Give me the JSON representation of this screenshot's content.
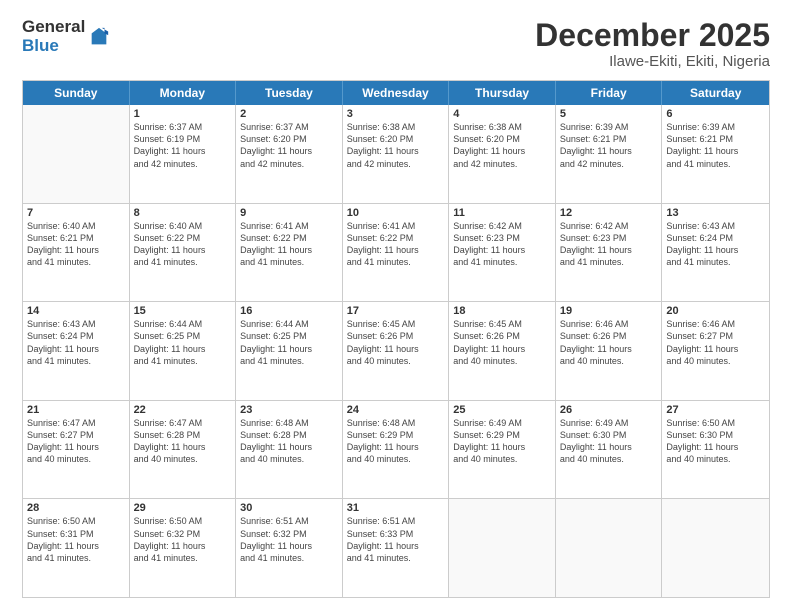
{
  "logo": {
    "general": "General",
    "blue": "Blue"
  },
  "title": "December 2025",
  "subtitle": "Ilawe-Ekiti, Ekiti, Nigeria",
  "days_of_week": [
    "Sunday",
    "Monday",
    "Tuesday",
    "Wednesday",
    "Thursday",
    "Friday",
    "Saturday"
  ],
  "weeks": [
    [
      {
        "num": "",
        "sunrise": "",
        "sunset": "",
        "daylight": "",
        "empty": true
      },
      {
        "num": "1",
        "sunrise": "6:37 AM",
        "sunset": "6:19 PM",
        "daylight": "11 hours and 42 minutes."
      },
      {
        "num": "2",
        "sunrise": "6:37 AM",
        "sunset": "6:20 PM",
        "daylight": "11 hours and 42 minutes."
      },
      {
        "num": "3",
        "sunrise": "6:38 AM",
        "sunset": "6:20 PM",
        "daylight": "11 hours and 42 minutes."
      },
      {
        "num": "4",
        "sunrise": "6:38 AM",
        "sunset": "6:20 PM",
        "daylight": "11 hours and 42 minutes."
      },
      {
        "num": "5",
        "sunrise": "6:39 AM",
        "sunset": "6:21 PM",
        "daylight": "11 hours and 42 minutes."
      },
      {
        "num": "6",
        "sunrise": "6:39 AM",
        "sunset": "6:21 PM",
        "daylight": "11 hours and 41 minutes."
      }
    ],
    [
      {
        "num": "7",
        "sunrise": "6:40 AM",
        "sunset": "6:21 PM",
        "daylight": "11 hours and 41 minutes."
      },
      {
        "num": "8",
        "sunrise": "6:40 AM",
        "sunset": "6:22 PM",
        "daylight": "11 hours and 41 minutes."
      },
      {
        "num": "9",
        "sunrise": "6:41 AM",
        "sunset": "6:22 PM",
        "daylight": "11 hours and 41 minutes."
      },
      {
        "num": "10",
        "sunrise": "6:41 AM",
        "sunset": "6:22 PM",
        "daylight": "11 hours and 41 minutes."
      },
      {
        "num": "11",
        "sunrise": "6:42 AM",
        "sunset": "6:23 PM",
        "daylight": "11 hours and 41 minutes."
      },
      {
        "num": "12",
        "sunrise": "6:42 AM",
        "sunset": "6:23 PM",
        "daylight": "11 hours and 41 minutes."
      },
      {
        "num": "13",
        "sunrise": "6:43 AM",
        "sunset": "6:24 PM",
        "daylight": "11 hours and 41 minutes."
      }
    ],
    [
      {
        "num": "14",
        "sunrise": "6:43 AM",
        "sunset": "6:24 PM",
        "daylight": "11 hours and 41 minutes."
      },
      {
        "num": "15",
        "sunrise": "6:44 AM",
        "sunset": "6:25 PM",
        "daylight": "11 hours and 41 minutes."
      },
      {
        "num": "16",
        "sunrise": "6:44 AM",
        "sunset": "6:25 PM",
        "daylight": "11 hours and 41 minutes."
      },
      {
        "num": "17",
        "sunrise": "6:45 AM",
        "sunset": "6:26 PM",
        "daylight": "11 hours and 40 minutes."
      },
      {
        "num": "18",
        "sunrise": "6:45 AM",
        "sunset": "6:26 PM",
        "daylight": "11 hours and 40 minutes."
      },
      {
        "num": "19",
        "sunrise": "6:46 AM",
        "sunset": "6:26 PM",
        "daylight": "11 hours and 40 minutes."
      },
      {
        "num": "20",
        "sunrise": "6:46 AM",
        "sunset": "6:27 PM",
        "daylight": "11 hours and 40 minutes."
      }
    ],
    [
      {
        "num": "21",
        "sunrise": "6:47 AM",
        "sunset": "6:27 PM",
        "daylight": "11 hours and 40 minutes."
      },
      {
        "num": "22",
        "sunrise": "6:47 AM",
        "sunset": "6:28 PM",
        "daylight": "11 hours and 40 minutes."
      },
      {
        "num": "23",
        "sunrise": "6:48 AM",
        "sunset": "6:28 PM",
        "daylight": "11 hours and 40 minutes."
      },
      {
        "num": "24",
        "sunrise": "6:48 AM",
        "sunset": "6:29 PM",
        "daylight": "11 hours and 40 minutes."
      },
      {
        "num": "25",
        "sunrise": "6:49 AM",
        "sunset": "6:29 PM",
        "daylight": "11 hours and 40 minutes."
      },
      {
        "num": "26",
        "sunrise": "6:49 AM",
        "sunset": "6:30 PM",
        "daylight": "11 hours and 40 minutes."
      },
      {
        "num": "27",
        "sunrise": "6:50 AM",
        "sunset": "6:30 PM",
        "daylight": "11 hours and 40 minutes."
      }
    ],
    [
      {
        "num": "28",
        "sunrise": "6:50 AM",
        "sunset": "6:31 PM",
        "daylight": "11 hours and 41 minutes."
      },
      {
        "num": "29",
        "sunrise": "6:50 AM",
        "sunset": "6:32 PM",
        "daylight": "11 hours and 41 minutes."
      },
      {
        "num": "30",
        "sunrise": "6:51 AM",
        "sunset": "6:32 PM",
        "daylight": "11 hours and 41 minutes."
      },
      {
        "num": "31",
        "sunrise": "6:51 AM",
        "sunset": "6:33 PM",
        "daylight": "11 hours and 41 minutes."
      },
      {
        "num": "",
        "sunrise": "",
        "sunset": "",
        "daylight": "",
        "empty": true
      },
      {
        "num": "",
        "sunrise": "",
        "sunset": "",
        "daylight": "",
        "empty": true
      },
      {
        "num": "",
        "sunrise": "",
        "sunset": "",
        "daylight": "",
        "empty": true
      }
    ]
  ]
}
